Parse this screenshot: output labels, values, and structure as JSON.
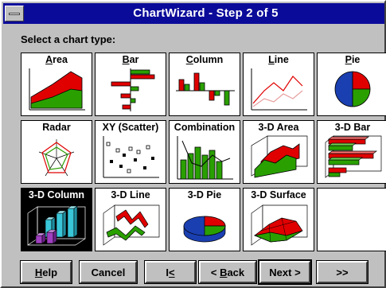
{
  "window": {
    "title": "ChartWizard - Step 2 of 5"
  },
  "prompt": "Select a chart type:",
  "chart_types": [
    {
      "label": "Area",
      "ul": "A",
      "rest": "rea",
      "icon": "area-chart-icon"
    },
    {
      "label": "Bar",
      "ul": "B",
      "rest": "ar",
      "icon": "bar-chart-icon"
    },
    {
      "label": "Column",
      "ul": "C",
      "rest": "olumn",
      "icon": "column-chart-icon"
    },
    {
      "label": "Line",
      "ul": "L",
      "rest": "ine",
      "icon": "line-chart-icon"
    },
    {
      "label": "Pie",
      "ul": "P",
      "rest": "ie",
      "icon": "pie-chart-icon"
    },
    {
      "label": "Radar",
      "ul": "",
      "rest": "Radar",
      "icon": "radar-chart-icon"
    },
    {
      "label": "XY (Scatter)",
      "ul": "",
      "rest": "XY (Scatter)",
      "icon": "scatter-chart-icon"
    },
    {
      "label": "Combination",
      "ul": "",
      "rest": "Combination",
      "icon": "combination-chart-icon"
    },
    {
      "label": "3-D Area",
      "ul": "",
      "rest": "3-D Area",
      "icon": "3d-area-chart-icon"
    },
    {
      "label": "3-D Bar",
      "ul": "",
      "rest": "3-D Bar",
      "icon": "3d-bar-chart-icon"
    },
    {
      "label": "3-D Column",
      "ul": "",
      "rest": "3-D Column",
      "icon": "3d-column-chart-icon",
      "selected": true
    },
    {
      "label": "3-D Line",
      "ul": "",
      "rest": "3-D Line",
      "icon": "3d-line-chart-icon"
    },
    {
      "label": "3-D Pie",
      "ul": "",
      "rest": "3-D Pie",
      "icon": "3d-pie-chart-icon"
    },
    {
      "label": "3-D Surface",
      "ul": "",
      "rest": "3-D Surface",
      "icon": "3d-surface-chart-icon"
    }
  ],
  "buttons": {
    "help": {
      "ul": "H",
      "rest": "elp"
    },
    "cancel": "Cancel",
    "first": {
      "text": "I<",
      "ul": "<"
    },
    "back": {
      "pre": "< ",
      "ul": "B",
      "rest": "ack"
    },
    "next": "Next >",
    "last": ">>"
  },
  "colors": {
    "title_bar": "#0b0b9a",
    "face": "#c0c0c0",
    "red": "#e00000",
    "green": "#2aa000",
    "blue": "#1a3fb0",
    "cyan": "#39c6d8",
    "purple": "#a040c0"
  }
}
